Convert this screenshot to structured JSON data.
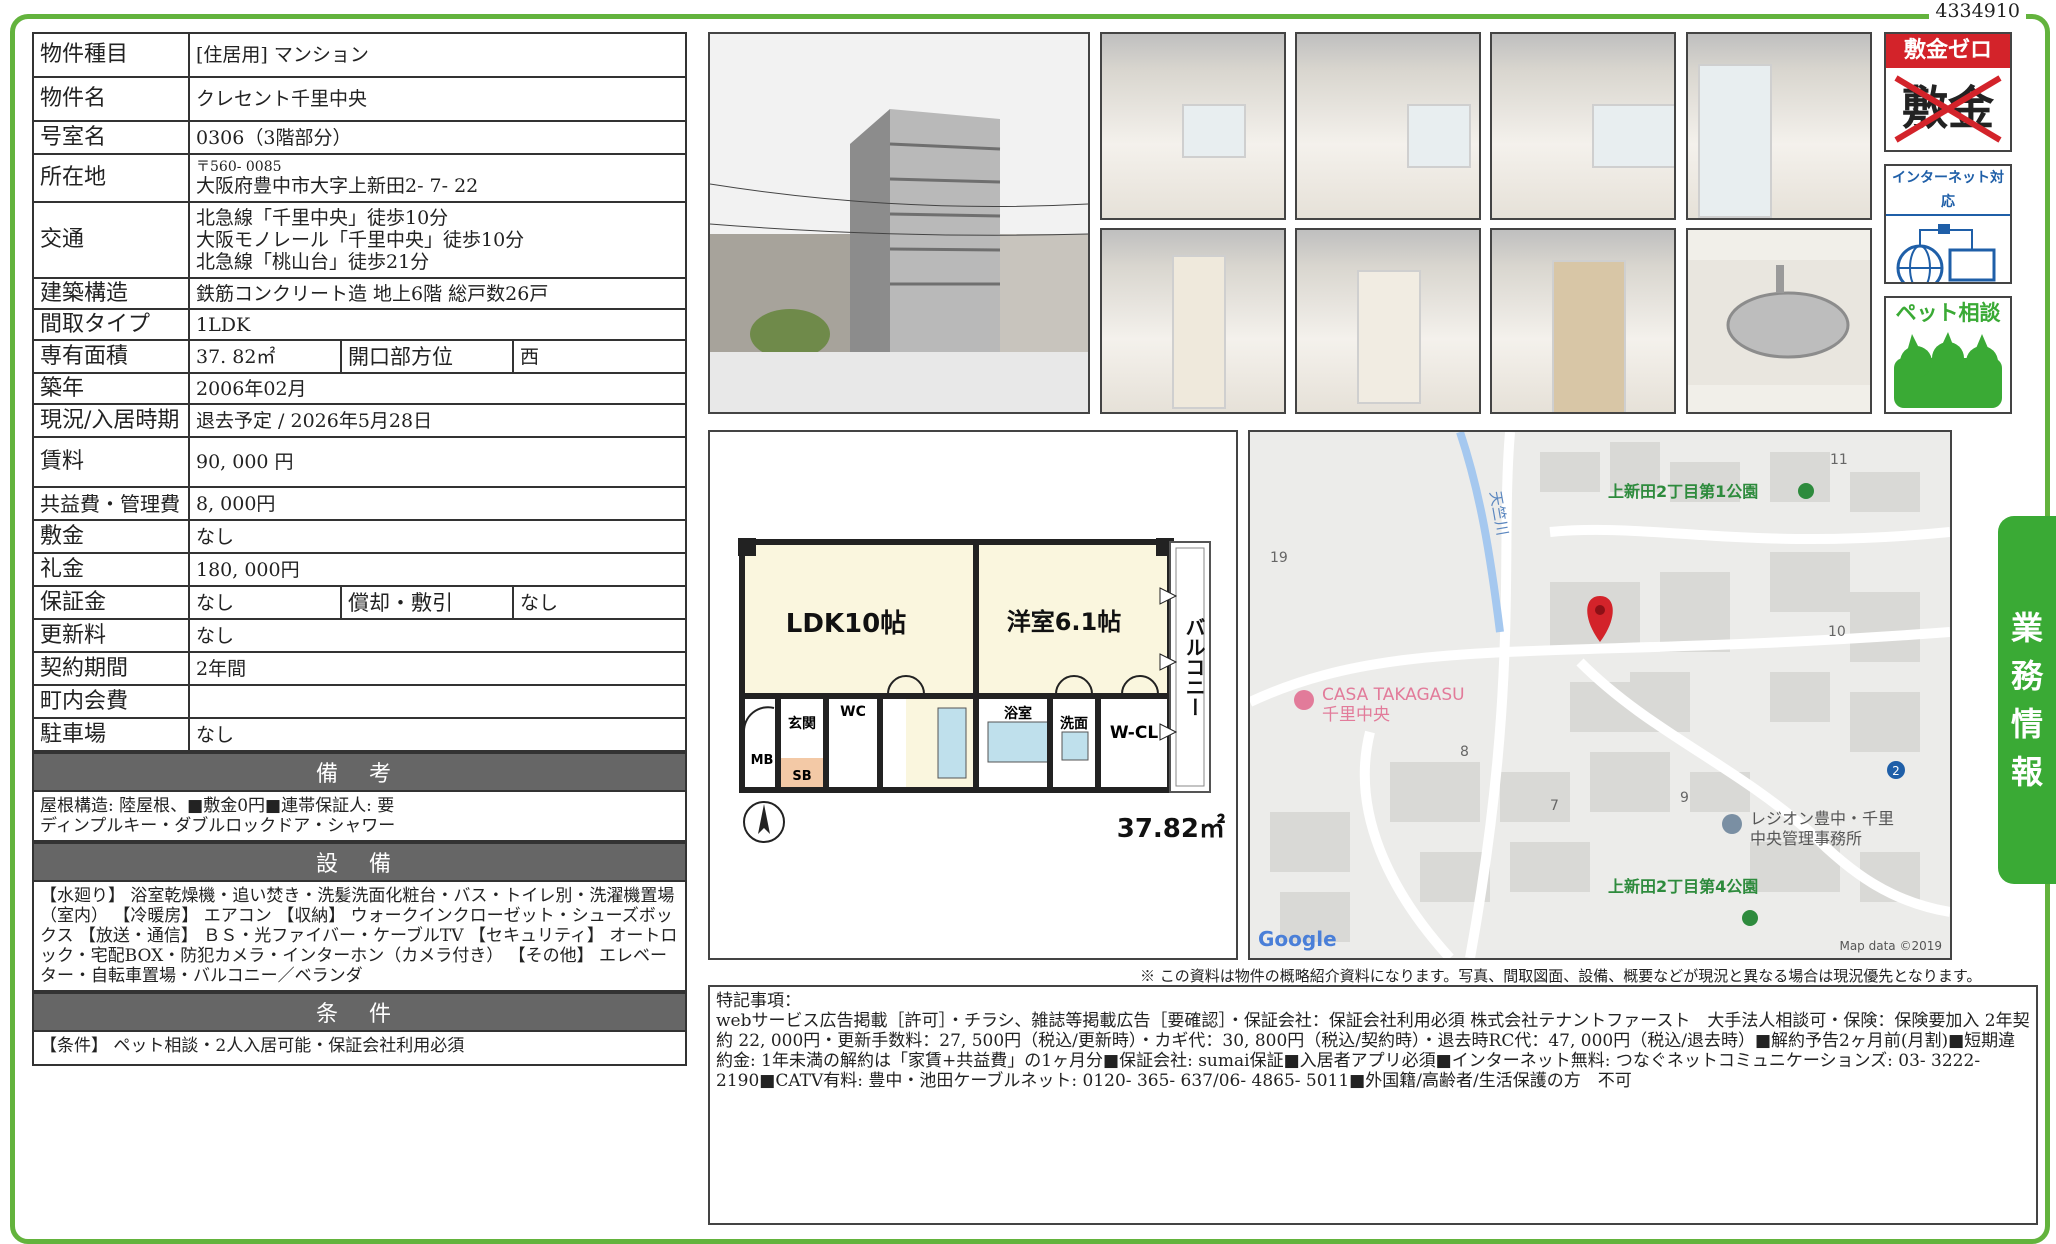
{
  "doc_id": "4334910",
  "property": {
    "type_label": "物件種目",
    "type_value": "[住居用] マンション",
    "name_label": "物件名",
    "name_value": "クレセント千里中央",
    "room_label": "号室名",
    "room_value": "0306（3階部分）",
    "address_label": "所在地",
    "address_zip": "〒560- 0085",
    "address_value": "大阪府豊中市大字上新田2- 7- 22",
    "transit_label": "交通",
    "transit_lines": [
      "北急線「千里中央」徒歩10分",
      "大阪モノレール「千里中央」徒歩10分",
      "北急線「桃山台」徒歩21分"
    ],
    "structure_label": "建築構造",
    "structure_value": "鉄筋コンクリート造 地上6階 総戸数26戸",
    "layout_label": "間取タイプ",
    "layout_value": "1LDK",
    "area_label": "専有面積",
    "area_value": "37. 82㎡",
    "direction_label": "開口部方位",
    "direction_value": "西",
    "built_label": "築年",
    "built_value": "2006年02月",
    "status_label": "現況/入居時期",
    "status_value": "退去予定 / 2026年5月28日",
    "rent_label": "賃料",
    "rent_value": "90, 000 円",
    "fee_label": "共益費・管理費",
    "fee_value": "8, 000円",
    "shikikin_label": "敷金",
    "shikikin_value": "なし",
    "reikin_label": "礼金",
    "reikin_value": "180, 000円",
    "hoshokin_label": "保証金",
    "hoshokin_value": "なし",
    "shokyaku_label": "償却・敷引",
    "shokyaku_value": "なし",
    "renewal_label": "更新料",
    "renewal_value": "なし",
    "contract_label": "契約期間",
    "contract_value": "2年間",
    "chonaikai_label": "町内会費",
    "chonaikai_value": "",
    "parking_label": "駐車場",
    "parking_value": "なし"
  },
  "remarks": {
    "title": "備 考",
    "text": "屋根構造: 陸屋根、■敷金0円■連帯保証人: 要\nディンプルキー・ダブルロックドア・シャワー"
  },
  "equipment": {
    "title": "設 備",
    "text": "【水廻り】 浴室乾燥機・追い焚き・洗髪洗面化粧台・バス・トイレ別・洗濯機置場（室内） 【冷暖房】 エアコン 【収納】 ウォークインクローゼット・シューズボックス 【放送・通信】 ＢＳ・光ファイバー・ケーブルTV 【セキュリティ】 オートロック・宅配BOX・防犯カメラ・インターホン（カメラ付き） 【その他】 エレベーター・自転車置場・バルコニー／ベランダ"
  },
  "conditions": {
    "title": "条 件",
    "text": "【条件】 ペット相談・2人入居可能・保証会社利用必須"
  },
  "badges": {
    "shikikin_zero": "敷金ゼロ",
    "shikikin_crossed": "敷金",
    "internet": "インターネット対応",
    "pet": "ペット相談"
  },
  "floorplan": {
    "ldk": "LDK10帖",
    "western": "洋室6.1帖",
    "balcony": "バルコニー",
    "genkan": "玄関",
    "wc": "WC",
    "bath": "浴室",
    "washroom": "洗面",
    "wcl": "W-CL",
    "mb": "MB",
    "sb": "SB",
    "area": "37.82㎡"
  },
  "map": {
    "park1": "上新田2丁目第1公園",
    "park4": "上新田2丁目第4公園",
    "casa": "CASA TAKAGASU",
    "casa_sub": "千里中央",
    "legion": "レジオン豊中・千里",
    "legion_sub": "中央管理事務所",
    "river": "天竺川",
    "n11": "11",
    "n19": "19",
    "n10": "10",
    "n8": "8",
    "n7": "7",
    "n9": "9",
    "n2": "2",
    "google": "Google",
    "mapdata": "Map data ©2019"
  },
  "disclaimer": "※ この資料は物件の概略紹介資料になります。写真、間取図面、設備、概要などが現況と異なる場合は現況優先となります。",
  "notes": {
    "title": "特記事項：",
    "text": "webサービス広告掲載［許可］・チラシ、雑誌等掲載広告［要確認］・保証会社：保証会社利用必須 株式会社テナントファースト　大手法人相談可・保険：保険要加入 2年契約 22, 000円・更新手数料：27, 500円（税込/更新時）・カギ代：30, 800円（税込/契約時）・退去時RC代：47, 000円（税込/退去時）■解約予告2ヶ月前(月割)■短期違約金: 1年未満の解約は「家賃+共益費」の1ヶ月分■保証会社: sumai保証■入居者アプリ必須■インターネット無料: つなぐネットコミュニケーションズ: 03- 3222- 2190■CATV有料: 豊中・池田ケーブルネット: 0120- 365- 637/06- 4865- 5011■外国籍/高齢者/生活保護の方　不可"
  },
  "side_tab": [
    "業",
    "務",
    "情",
    "報"
  ],
  "colors": {
    "frame": "#63b33d",
    "section": "#666666",
    "badge_red": "#d3232a",
    "badge_blue": "#1f5fa8",
    "pet_green": "#3aaa35"
  }
}
